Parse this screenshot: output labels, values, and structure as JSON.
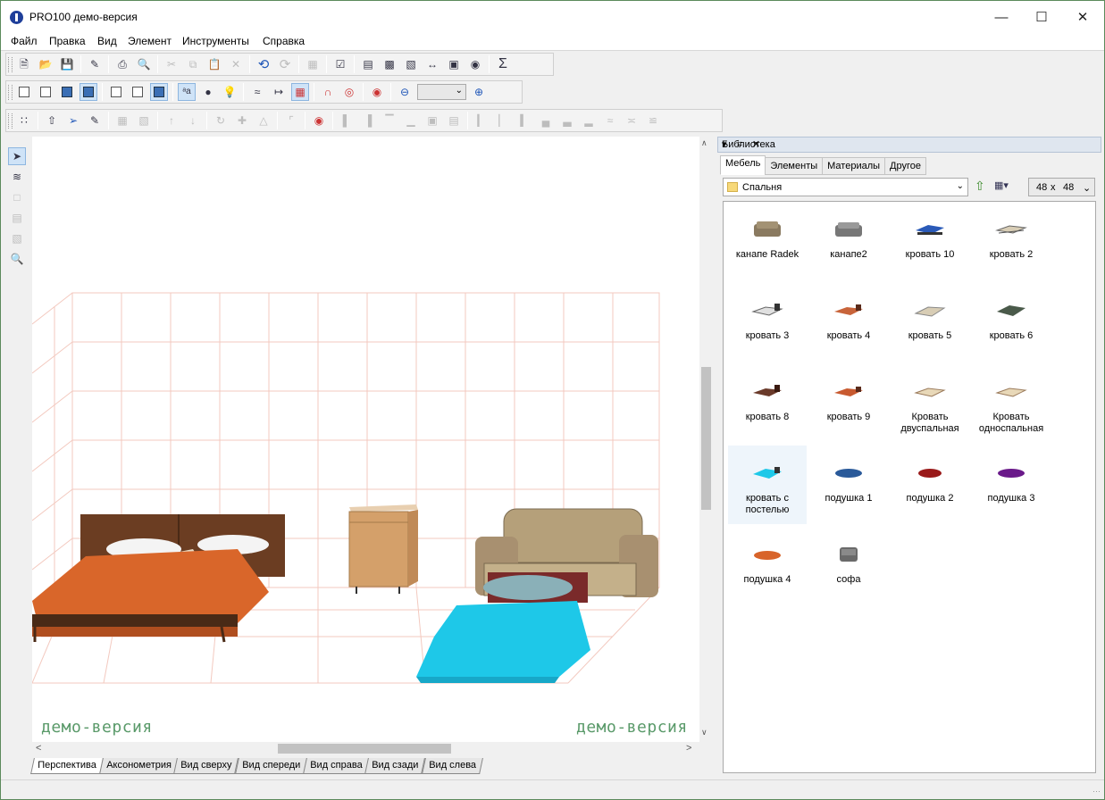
{
  "window": {
    "title": "PRO100 демо-версия"
  },
  "menu": [
    "Файл",
    "Правка",
    "Вид",
    "Элемент",
    "Инструменты",
    "Справка"
  ],
  "view_tabs": [
    "Перспектива",
    "Аксонометрия",
    "Вид сверху",
    "Вид спереди",
    "Вид справа",
    "Вид сзади",
    "Вид слева"
  ],
  "watermark": {
    "left": "демо-версия",
    "right": "демо-версия"
  },
  "library": {
    "title": "Библиотека",
    "tabs": [
      "Мебель",
      "Элементы",
      "Материалы",
      "Другое"
    ],
    "folder": "Спальня",
    "size": {
      "w": "48",
      "x": "x",
      "h": "48"
    },
    "items": [
      "канапе Radek",
      "канапе2",
      "кровать 10",
      "кровать 2",
      "кровать 3",
      "кровать 4",
      "кровать 5",
      "кровать 6",
      "кровать 8",
      "кровать 9",
      "Кровать двуспальная",
      "Кровать односпальная",
      "кровать с постелью",
      "подушка 1",
      "подушка 2",
      "подушка 3",
      "подушка 4",
      "софа"
    ]
  },
  "icons": [
    "new-icon",
    "open-icon",
    "save-icon",
    "properties-icon",
    "print-icon",
    "print-preview-icon",
    "cut-icon",
    "copy-icon",
    "paste-icon",
    "delete-icon",
    "undo-icon",
    "redo-icon",
    "sigma-icon",
    "zoom-out-icon",
    "zoom-in-icon",
    "select-arrow-icon",
    "magnifier-icon"
  ],
  "colors": {
    "accent": "#3b6fb5",
    "watermark": "#5a9a6a",
    "bedspread": "#d9662a",
    "blue_sheet": "#1ec8e8",
    "plaid": "#b5a07a",
    "cabinet": "#d4a06a"
  }
}
